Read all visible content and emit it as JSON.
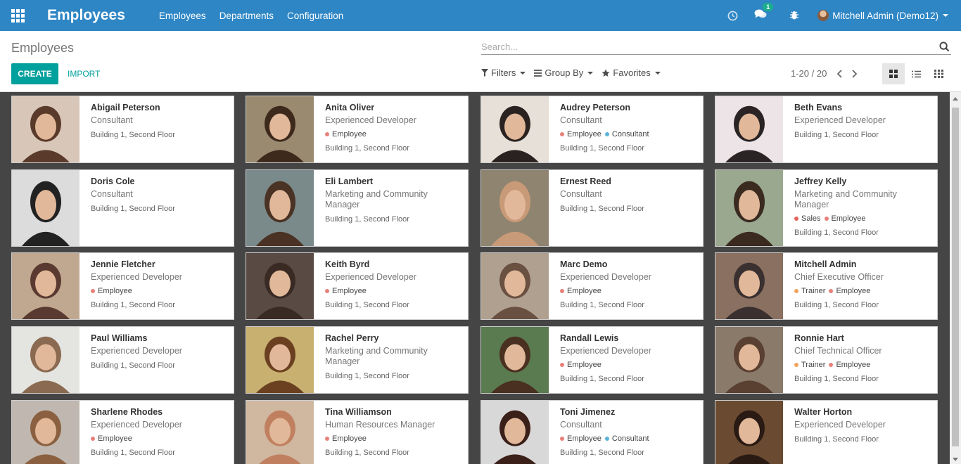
{
  "app": {
    "title": "Employees",
    "menu": [
      "Employees",
      "Departments",
      "Configuration"
    ],
    "chat_badge": "1",
    "user": "Mitchell Admin (Demo12)"
  },
  "control_panel": {
    "breadcrumb": "Employees",
    "create_label": "CREATE",
    "import_label": "IMPORT",
    "search_placeholder": "Search...",
    "filters_label": "Filters",
    "group_by_label": "Group By",
    "favorites_label": "Favorites",
    "pager": "1-20 / 20",
    "active_view": "kanban"
  },
  "colors": {
    "navbar": "#2e86c5",
    "primary": "#00a09d",
    "tag_employee": "#e8807a",
    "tag_consultant": "#5ab4d8",
    "tag_sales": "#e8625a",
    "tag_trainer": "#f0a35a"
  },
  "employees": [
    {
      "name": "Abigail Peterson",
      "job": "Consultant",
      "tags": [],
      "location": "Building 1, Second Floor"
    },
    {
      "name": "Anita Oliver",
      "job": "Experienced Developer",
      "tags": [
        {
          "label": "Employee",
          "color": "#e8807a"
        }
      ],
      "location": "Building 1, Second Floor"
    },
    {
      "name": "Audrey Peterson",
      "job": "Consultant",
      "tags": [
        {
          "label": "Employee",
          "color": "#e8807a"
        },
        {
          "label": "Consultant",
          "color": "#5ab4d8"
        }
      ],
      "location": "Building 1, Second Floor"
    },
    {
      "name": "Beth Evans",
      "job": "Experienced Developer",
      "tags": [],
      "location": "Building 1, Second Floor"
    },
    {
      "name": "Doris Cole",
      "job": "Consultant",
      "tags": [],
      "location": "Building 1, Second Floor"
    },
    {
      "name": "Eli Lambert",
      "job": "Marketing and Community Manager",
      "tags": [],
      "location": "Building 1, Second Floor"
    },
    {
      "name": "Ernest Reed",
      "job": "Consultant",
      "tags": [],
      "location": "Building 1, Second Floor"
    },
    {
      "name": "Jeffrey Kelly",
      "job": "Marketing and Community Manager",
      "tags": [
        {
          "label": "Sales",
          "color": "#e8625a"
        },
        {
          "label": "Employee",
          "color": "#e8807a"
        }
      ],
      "location": "Building 1, Second Floor"
    },
    {
      "name": "Jennie Fletcher",
      "job": "Experienced Developer",
      "tags": [
        {
          "label": "Employee",
          "color": "#e8807a"
        }
      ],
      "location": "Building 1, Second Floor"
    },
    {
      "name": "Keith Byrd",
      "job": "Experienced Developer",
      "tags": [
        {
          "label": "Employee",
          "color": "#e8807a"
        }
      ],
      "location": "Building 1, Second Floor"
    },
    {
      "name": "Marc Demo",
      "job": "Experienced Developer",
      "tags": [
        {
          "label": "Employee",
          "color": "#e8807a"
        }
      ],
      "location": "Building 1, Second Floor"
    },
    {
      "name": "Mitchell Admin",
      "job": "Chief Executive Officer",
      "tags": [
        {
          "label": "Trainer",
          "color": "#f0a35a"
        },
        {
          "label": "Employee",
          "color": "#e8807a"
        }
      ],
      "location": "Building 1, Second Floor"
    },
    {
      "name": "Paul Williams",
      "job": "Experienced Developer",
      "tags": [],
      "location": "Building 1, Second Floor"
    },
    {
      "name": "Rachel Perry",
      "job": "Marketing and Community Manager",
      "tags": [],
      "location": "Building 1, Second Floor"
    },
    {
      "name": "Randall Lewis",
      "job": "Experienced Developer",
      "tags": [
        {
          "label": "Employee",
          "color": "#e8807a"
        }
      ],
      "location": "Building 1, Second Floor"
    },
    {
      "name": "Ronnie Hart",
      "job": "Chief Technical Officer",
      "tags": [
        {
          "label": "Trainer",
          "color": "#f0a35a"
        },
        {
          "label": "Employee",
          "color": "#e8807a"
        }
      ],
      "location": "Building 1, Second Floor"
    },
    {
      "name": "Sharlene Rhodes",
      "job": "Experienced Developer",
      "tags": [
        {
          "label": "Employee",
          "color": "#e8807a"
        }
      ],
      "location": "Building 1, Second Floor"
    },
    {
      "name": "Tina Williamson",
      "job": "Human Resources Manager",
      "tags": [
        {
          "label": "Employee",
          "color": "#e8807a"
        }
      ],
      "location": "Building 1, Second Floor"
    },
    {
      "name": "Toni Jimenez",
      "job": "Consultant",
      "tags": [
        {
          "label": "Employee",
          "color": "#e8807a"
        },
        {
          "label": "Consultant",
          "color": "#5ab4d8"
        }
      ],
      "location": "Building 1, Second Floor"
    },
    {
      "name": "Walter Horton",
      "job": "Experienced Developer",
      "tags": [],
      "location": "Building 1, Second Floor"
    }
  ]
}
